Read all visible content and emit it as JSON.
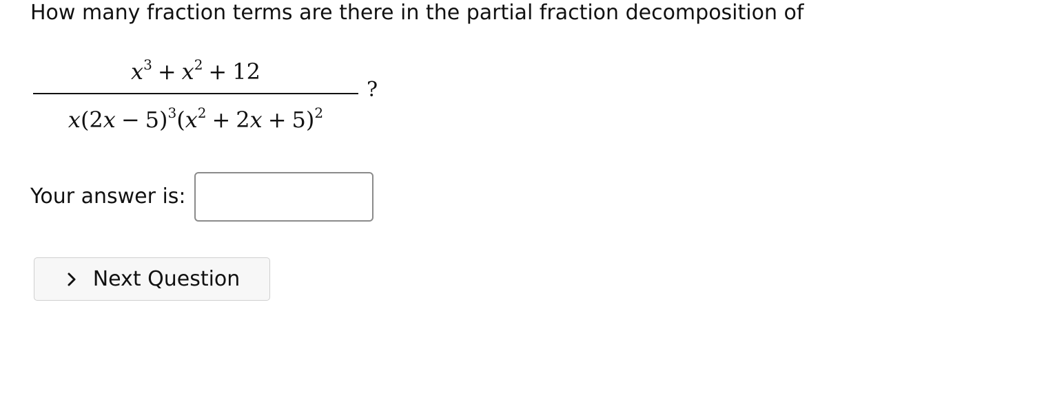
{
  "question": {
    "text": "How many fraction terms are there in the partial fraction decomposition of"
  },
  "expression": {
    "numerator": {
      "term1_base": "x",
      "term1_exp": "3",
      "op1": "+",
      "term2_base": "x",
      "term2_exp": "2",
      "op2": "+",
      "term3": "12"
    },
    "denominator": {
      "lead_var": "x",
      "f1_open": "(2",
      "f1_var": "x",
      "f1_op": "−",
      "f1_close": "5)",
      "f1_exp": "3",
      "f2_open": "(",
      "f2_var1": "x",
      "f2_var1_exp": "2",
      "f2_op1": "+",
      "f2_coef": "2",
      "f2_var2": "x",
      "f2_op2": "+",
      "f2_close": "5)",
      "f2_exp": "2"
    },
    "trailing": "?"
  },
  "answer": {
    "label": "Your answer is:",
    "value": ""
  },
  "next_button": {
    "label": "Next Question",
    "icon": "chevron-right-icon"
  }
}
